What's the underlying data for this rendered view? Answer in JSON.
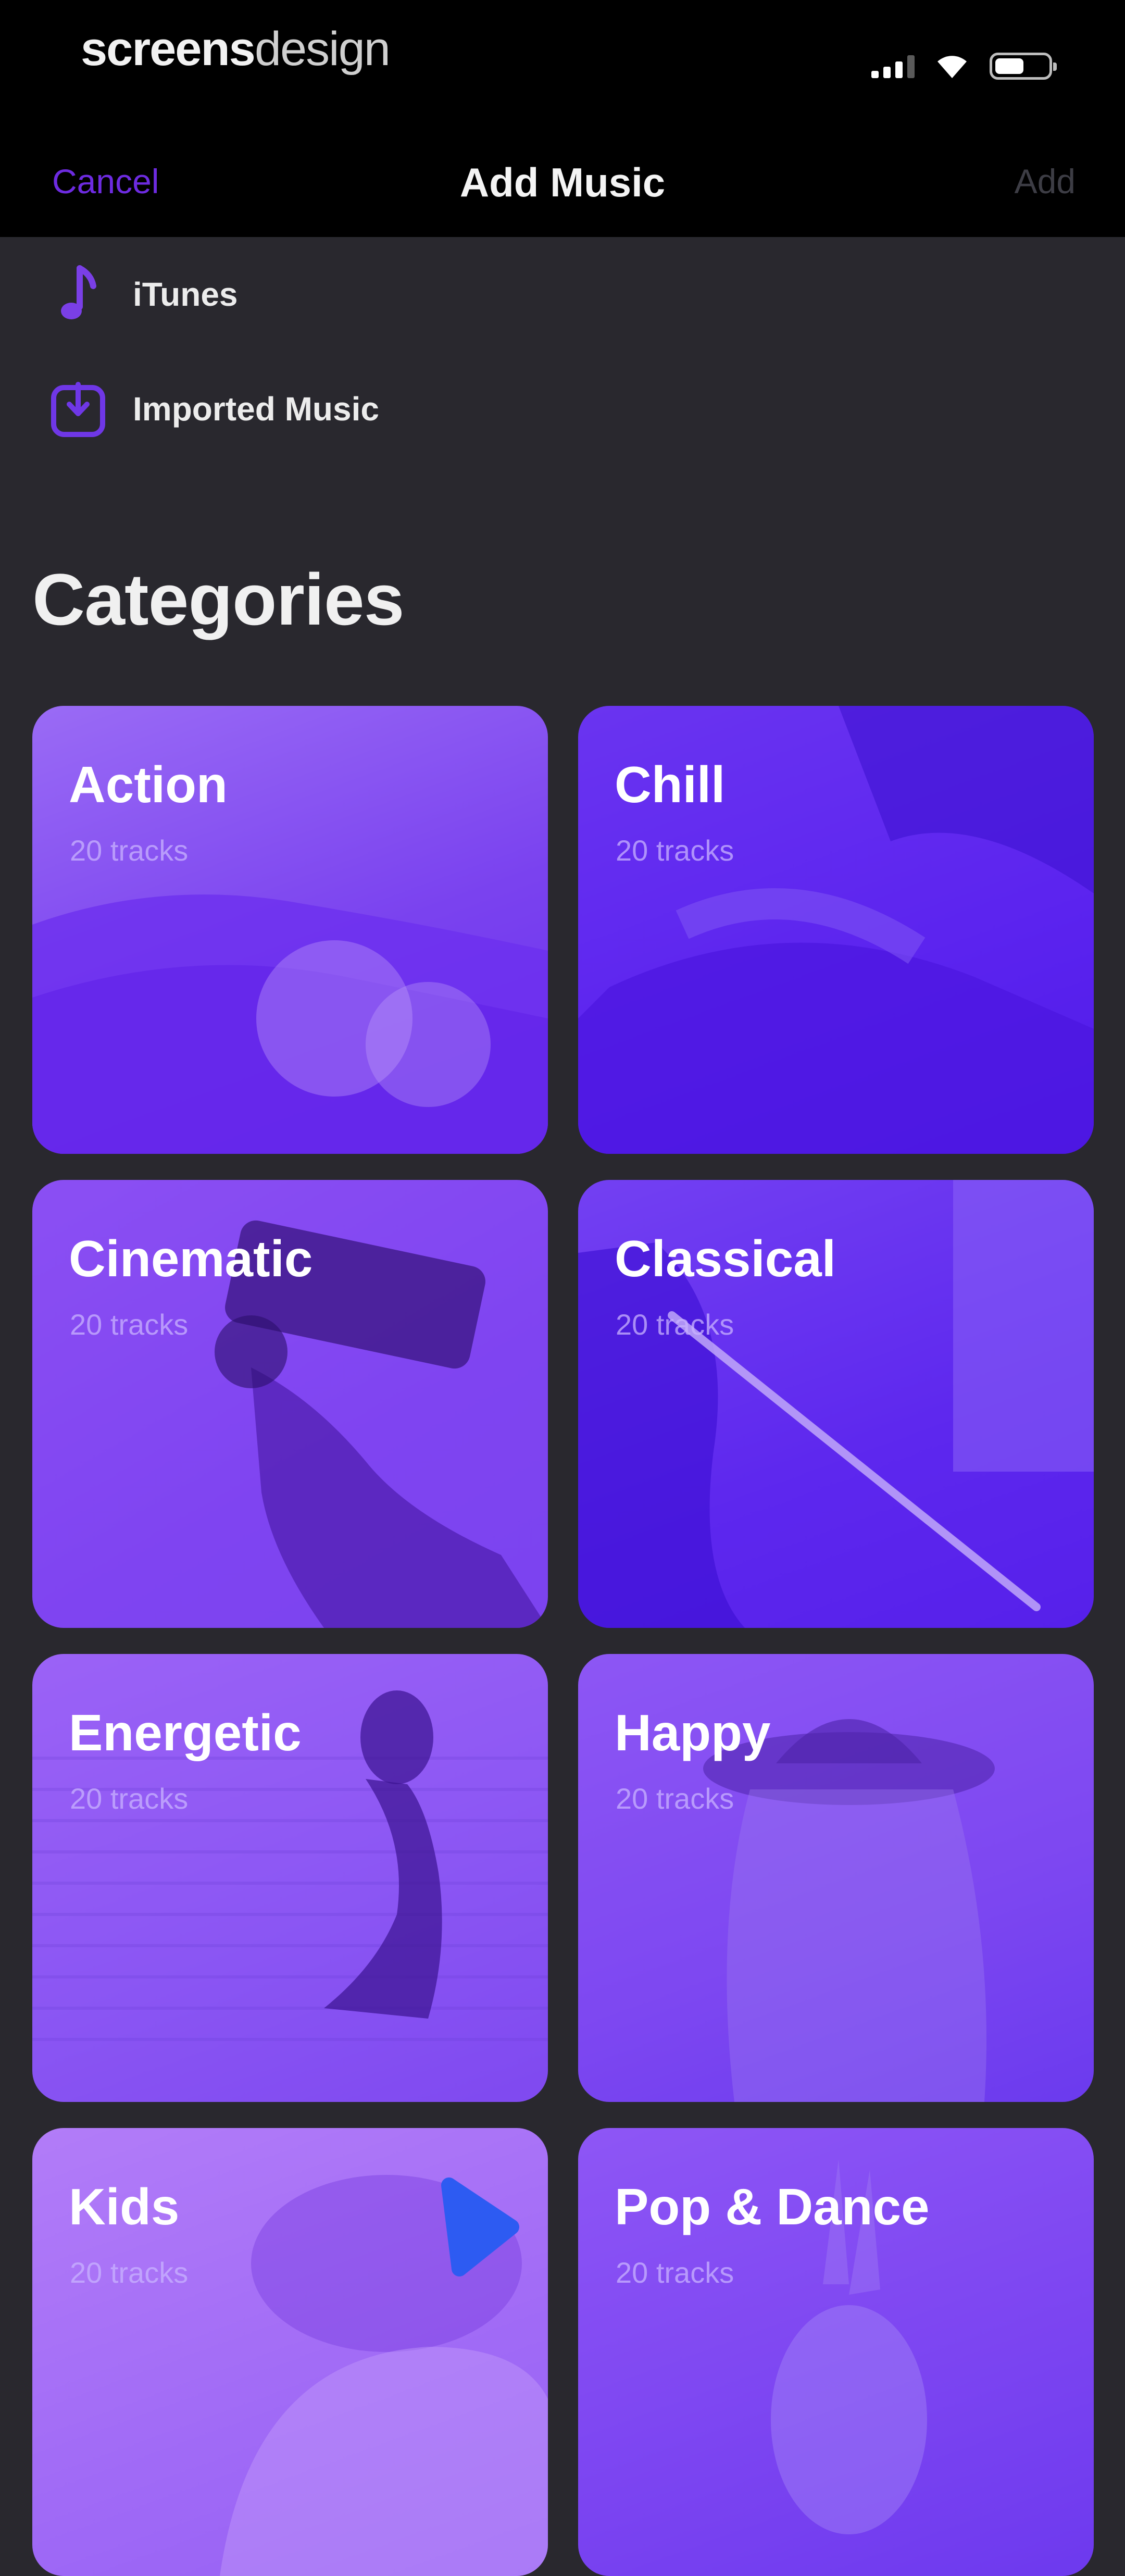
{
  "status_bar": {
    "brand_bold": "screens",
    "brand_light": "design"
  },
  "nav": {
    "cancel_label": "Cancel",
    "title": "Add Music",
    "add_label": "Add"
  },
  "sources": [
    {
      "label": "iTunes",
      "icon": "music-note-icon"
    },
    {
      "label": "Imported Music",
      "icon": "import-icon"
    }
  ],
  "categories_heading": "Categories",
  "categories": [
    {
      "title": "Action",
      "count": "20 tracks"
    },
    {
      "title": "Chill",
      "count": "20 tracks"
    },
    {
      "title": "Cinematic",
      "count": "20 tracks"
    },
    {
      "title": "Classical",
      "count": "20 tracks"
    },
    {
      "title": "Energetic",
      "count": "20 tracks"
    },
    {
      "title": "Happy",
      "count": "20 tracks"
    },
    {
      "title": "Kids",
      "count": "20 tracks"
    },
    {
      "title": "Pop & Dance",
      "count": "20 tracks"
    }
  ],
  "colors": {
    "accent": "#6d2be0",
    "background": "#29282e",
    "topbar": "#000000",
    "card_purple": "#7a42ef"
  }
}
